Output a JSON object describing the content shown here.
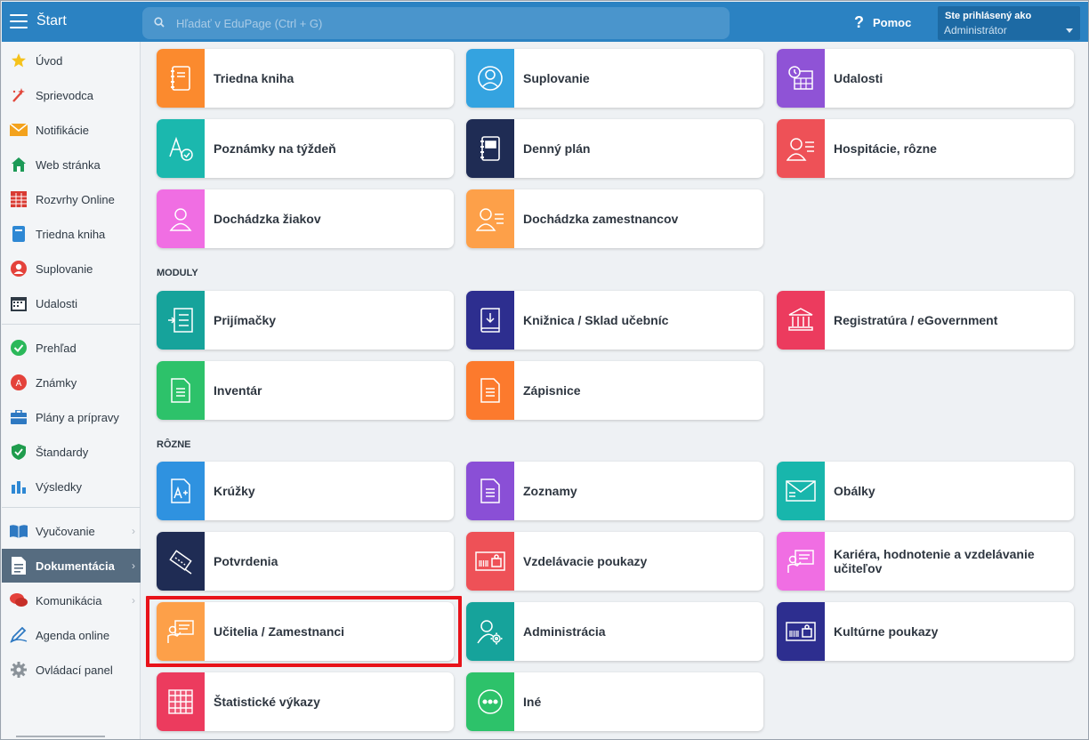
{
  "topbar": {
    "title": "Štart",
    "search_placeholder": "Hľadať v EduPage (Ctrl + G)",
    "help_label": "Pomoc",
    "user_line1": "Ste prihlásený ako",
    "user_line2": "Administrátor"
  },
  "sidebar": {
    "items": [
      {
        "label": "Úvod",
        "icon": "star-icon"
      },
      {
        "label": "Sprievodca",
        "icon": "magic-wand-icon"
      },
      {
        "label": "Notifikácie",
        "icon": "envelope-icon"
      },
      {
        "label": "Web stránka",
        "icon": "house-icon"
      },
      {
        "label": "Rozvrhy Online",
        "icon": "timetable-grid-icon"
      },
      {
        "label": "Triedna kniha",
        "icon": "book-icon"
      },
      {
        "label": "Suplovanie",
        "icon": "person-icon"
      },
      {
        "label": "Udalosti",
        "icon": "calendar-icon"
      },
      {
        "label": "Prehľad",
        "icon": "check-circle-icon"
      },
      {
        "label": "Známky",
        "icon": "grade-icon"
      },
      {
        "label": "Plány a prípravy",
        "icon": "briefcase-icon"
      },
      {
        "label": "Štandardy",
        "icon": "shield-check-icon"
      },
      {
        "label": "Výsledky",
        "icon": "bar-chart-icon"
      },
      {
        "label": "Vyučovanie",
        "icon": "open-book-icon"
      },
      {
        "label": "Dokumentácia",
        "icon": "document-icon"
      },
      {
        "label": "Komunikácia",
        "icon": "chat-bubbles-icon"
      },
      {
        "label": "Agenda online",
        "icon": "pen-icon"
      },
      {
        "label": "Ovládací panel",
        "icon": "gear-icon"
      }
    ]
  },
  "sections": {
    "moduly": "MODULY",
    "rozne": "RÔZNE"
  },
  "tiles": [
    {
      "label": "Triedna kniha",
      "color": "#fb8a2e",
      "icon": "notebook-icon"
    },
    {
      "label": "Suplovanie",
      "color": "#34a3e0",
      "icon": "person-swap-icon"
    },
    {
      "label": "Udalosti",
      "color": "#8f53d6",
      "icon": "calendar-clock-icon"
    },
    {
      "label": "Poznámky na týždeň",
      "color": "#1bb8ae",
      "icon": "letter-check-icon"
    },
    {
      "label": "Denný plán",
      "color": "#1f2c54",
      "icon": "planner-icon"
    },
    {
      "label": "Hospitácie, rôzne",
      "color": "#ee5157",
      "icon": "person-list-icon"
    },
    {
      "label": "Dochádzka žiakov",
      "color": "#f06ee3",
      "icon": "student-icon"
    },
    {
      "label": "Dochádzka zamestnancov",
      "color": "#fda049",
      "icon": "employee-list-icon"
    },
    {
      "label": "Prijímačky",
      "color": "#16a39b",
      "icon": "admission-form-icon"
    },
    {
      "label": "Knižnica / Sklad učebníc",
      "color": "#2d2e8f",
      "icon": "library-book-icon"
    },
    {
      "label": "Registratúra / eGovernment",
      "color": "#ec3b5e",
      "icon": "government-building-icon"
    },
    {
      "label": "Inventár",
      "color": "#2dc26a",
      "icon": "inventory-sheet-icon"
    },
    {
      "label": "Zápisnice",
      "color": "#fc7a2d",
      "icon": "minutes-sheet-icon"
    },
    {
      "label": "Krúžky",
      "color": "#2f92e0",
      "icon": "grade-sheet-icon"
    },
    {
      "label": "Zoznamy",
      "color": "#8a4fd6",
      "icon": "list-sheet-icon"
    },
    {
      "label": "Obálky",
      "color": "#18b6ac",
      "icon": "envelope-icon"
    },
    {
      "label": "Potvrdenia",
      "color": "#1f2c54",
      "icon": "stamp-icon"
    },
    {
      "label": "Vzdelávacie poukazy",
      "color": "#ee5157",
      "icon": "voucher-icon"
    },
    {
      "label": "Kariéra, hodnotenie a vzdelávanie učiteľov",
      "color": "#f06ee3",
      "icon": "teacher-board-icon"
    },
    {
      "label": "Učitelia / Zamestnanci",
      "color": "#fda049",
      "icon": "teacher-presentation-icon"
    },
    {
      "label": "Administrácia",
      "color": "#16a39b",
      "icon": "admin-person-gear-icon"
    },
    {
      "label": "Kultúrne poukazy",
      "color": "#2d2e8f",
      "icon": "culture-voucher-icon"
    },
    {
      "label": "Štatistické výkazy",
      "color": "#ec3b5e",
      "icon": "statistics-grid-icon"
    },
    {
      "label": "Iné",
      "color": "#2dc26a",
      "icon": "more-dots-icon"
    }
  ]
}
